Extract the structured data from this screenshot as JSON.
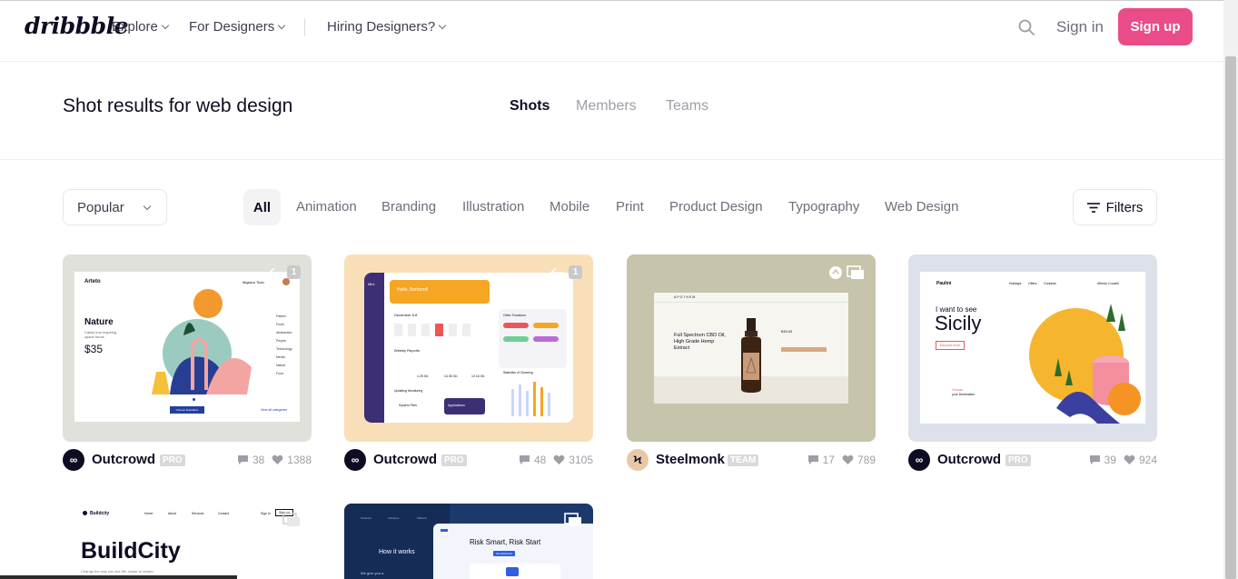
{
  "nav": {
    "logo": "dribbble",
    "links": [
      {
        "label": "Explore"
      },
      {
        "label": "For Designers"
      },
      {
        "label": "Hiring Designers?"
      }
    ],
    "signin": "Sign in",
    "signup": "Sign up"
  },
  "header": {
    "title": "Shot results for web design",
    "tabs": [
      "Shots",
      "Members",
      "Teams"
    ],
    "active_tab": "Shots"
  },
  "filters": {
    "sort": "Popular",
    "categories": [
      "All",
      "Animation",
      "Branding",
      "Illustration",
      "Mobile",
      "Print",
      "Product Design",
      "Typography",
      "Web Design"
    ],
    "active_category": "All",
    "filters_label": "Filters"
  },
  "shots": [
    {
      "author": "Outcrowd",
      "tag": "PRO",
      "comments": "38",
      "likes": "1388",
      "attachments": "1",
      "preview": {
        "brand": "Arteto",
        "heading": "Nature",
        "price": "$35",
        "sub": "Caluly true inspiring space forms",
        "cta": "Choose illustration",
        "link": "View all categories",
        "user": "Migiano Todo"
      },
      "bg": "#e1e1dc"
    },
    {
      "author": "Outcrowd",
      "tag": "PRO",
      "comments": "48",
      "likes": "3105",
      "attachments": "1",
      "preview": {
        "brand": "Mini",
        "greeting": "Hello, Borbond!",
        "date": "December 5-8",
        "section1": "Weekly Reports",
        "section2": "Other Functions",
        "section3": "Statistics of Cleaning",
        "stat1": "1.25 Gb",
        "stat2": "14.35 Gb",
        "stat3": "12.16 Gb",
        "section4": "Updating Monitoring",
        "label1": "System Files",
        "label2": "Applications"
      },
      "bg": "#f9dfb7"
    },
    {
      "author": "Steelmonk",
      "tag": "TEAM",
      "comments": "17",
      "likes": "789",
      "preview": {
        "brand": "APOTHEM",
        "heading": "Full Spectrum CBD Oil, High Grade Hemp Extract",
        "price": "€49.00"
      },
      "bg": "#c6c4aa"
    },
    {
      "author": "Outcrowd",
      "tag": "PRO",
      "comments": "39",
      "likes": "924",
      "preview": {
        "brand": "Paulini",
        "line1": "I want to see",
        "heading": "Sicily",
        "cta": "Discover more",
        "note1": "Choose",
        "note2": "your Destination",
        "user": "Alfredo Crowell",
        "menu": [
          "Holidays",
          "Offers",
          "Contacts"
        ]
      },
      "bg": "#dde1ea"
    },
    {
      "preview": {
        "brand": "Buildcity",
        "heading": "BuildCity",
        "sub": "Change the way you live life, closer to dream",
        "menu": [
          "Home",
          "About",
          "Services",
          "Contact"
        ],
        "signin": "Sign in",
        "signup": "Sign up"
      },
      "bg": "#f1f1f1"
    },
    {
      "preview": {
        "left_heading": "How it works",
        "left_sub": "We give you a",
        "heading": "Risk Smart, Risk Start",
        "cta": "Get started now",
        "menu": [
          "Products",
          "Solutions",
          "Platform"
        ]
      },
      "bg": "#1b3a6b"
    }
  ],
  "colors": {
    "brand": "#ea4c89",
    "text": "#0d0c22",
    "muted": "#6e6d7a"
  }
}
